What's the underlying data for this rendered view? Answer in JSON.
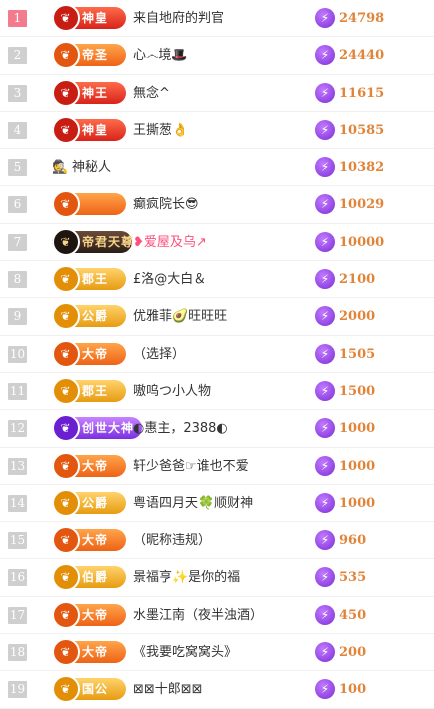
{
  "ranking": {
    "rows": [
      {
        "rank": "1",
        "badge": "神皇",
        "badge_color": "red",
        "name": "来自地府的判官",
        "score": "24798"
      },
      {
        "rank": "2",
        "badge": "帝圣",
        "badge_color": "orange",
        "name": "心෴境🎩",
        "score": "24440"
      },
      {
        "rank": "3",
        "badge": "神王",
        "badge_color": "red",
        "name": "無念^",
        "score": "11615"
      },
      {
        "rank": "4",
        "badge": "神皇",
        "badge_color": "red",
        "name": "王撕葱👌",
        "score": "10585"
      },
      {
        "rank": "5",
        "badge": "",
        "badge_color": "none",
        "name": "神秘人",
        "score": "10382",
        "mystery": true
      },
      {
        "rank": "6",
        "badge": "",
        "badge_color": "orange",
        "name": "癫疯院长😎",
        "score": "10029"
      },
      {
        "rank": "7",
        "badge": "帝君天尊",
        "badge_color": "dark",
        "name": "❥爱屋及乌↗",
        "score": "10000",
        "pink": true
      },
      {
        "rank": "8",
        "badge": "郡王",
        "badge_color": "gold",
        "name": "£洛@大白＆",
        "score": "2100"
      },
      {
        "rank": "9",
        "badge": "公爵",
        "badge_color": "gold",
        "name": "优雅菲🥑旺旺旺",
        "score": "2000"
      },
      {
        "rank": "10",
        "badge": "大帝",
        "badge_color": "orange",
        "name": "（选择）",
        "score": "1505"
      },
      {
        "rank": "11",
        "badge": "郡王",
        "badge_color": "gold",
        "name": "嗷呜つ小人物",
        "score": "1500"
      },
      {
        "rank": "12",
        "badge": "创世大神",
        "badge_color": "purple",
        "name": "◐惠主，2388◐",
        "score": "1000"
      },
      {
        "rank": "13",
        "badge": "大帝",
        "badge_color": "orange",
        "name": "轩少爸爸☞谁也不爱",
        "score": "1000"
      },
      {
        "rank": "14",
        "badge": "公爵",
        "badge_color": "gold",
        "name": "粤语四月天🍀顺财神",
        "score": "1000"
      },
      {
        "rank": "15",
        "badge": "大帝",
        "badge_color": "orange",
        "name": "（昵称违规）",
        "score": "960"
      },
      {
        "rank": "16",
        "badge": "伯爵",
        "badge_color": "gold",
        "name": "景福亨✨是你的福",
        "score": "535"
      },
      {
        "rank": "17",
        "badge": "大帝",
        "badge_color": "orange",
        "name": "水墨江南（夜半浊酒）",
        "score": "450"
      },
      {
        "rank": "18",
        "badge": "大帝",
        "badge_color": "orange",
        "name": "《我要吃窝窝头》",
        "score": "200"
      },
      {
        "rank": "19",
        "badge": "国公",
        "badge_color": "gold",
        "name": "⊠⊠十郎⊠⊠",
        "score": "100"
      }
    ]
  }
}
